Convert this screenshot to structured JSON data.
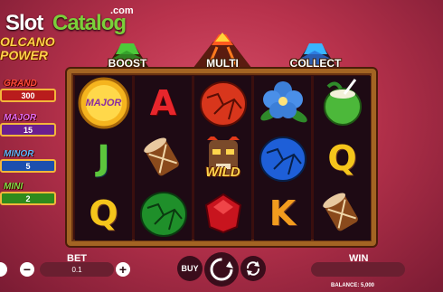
{
  "watermark": {
    "part1": "Slot",
    "part2": "Catalog",
    "suffix": ".com"
  },
  "game_logo": {
    "line1": "OLCANO",
    "line2": "POWER"
  },
  "features": {
    "boost": "BOOST",
    "multi": "MULTI",
    "collect": "COLLECT"
  },
  "jackpots": {
    "grand": {
      "title": "GRAND",
      "value": "300"
    },
    "major": {
      "title": "MAJOR",
      "value": "15"
    },
    "minor": {
      "title": "MINOR",
      "value": "5"
    },
    "mini": {
      "title": "MINI",
      "value": "2"
    }
  },
  "reels": [
    [
      "MAJOR coin",
      "J",
      "Q"
    ],
    [
      "A",
      "drum",
      "green egg"
    ],
    [
      "red egg",
      "tiki WILD",
      "red gem"
    ],
    [
      "blue flower",
      "blue egg",
      "K"
    ],
    [
      "coconut",
      "Q",
      "drum"
    ]
  ],
  "symbols": {
    "major_coin_label": "MAJOR",
    "wild_label": "WILD",
    "a": "A",
    "j": "J",
    "q": "Q",
    "k": "K"
  },
  "controls": {
    "bet_label": "BET",
    "bet_value": "0.1",
    "minus": "−",
    "plus": "+",
    "buy_label": "BUY",
    "win_label": "WIN",
    "balance_text": "BALANCE: 5,000"
  },
  "colors": {
    "frame": "#a36423",
    "background": "#b8324c",
    "wild": "#ffd54d"
  }
}
